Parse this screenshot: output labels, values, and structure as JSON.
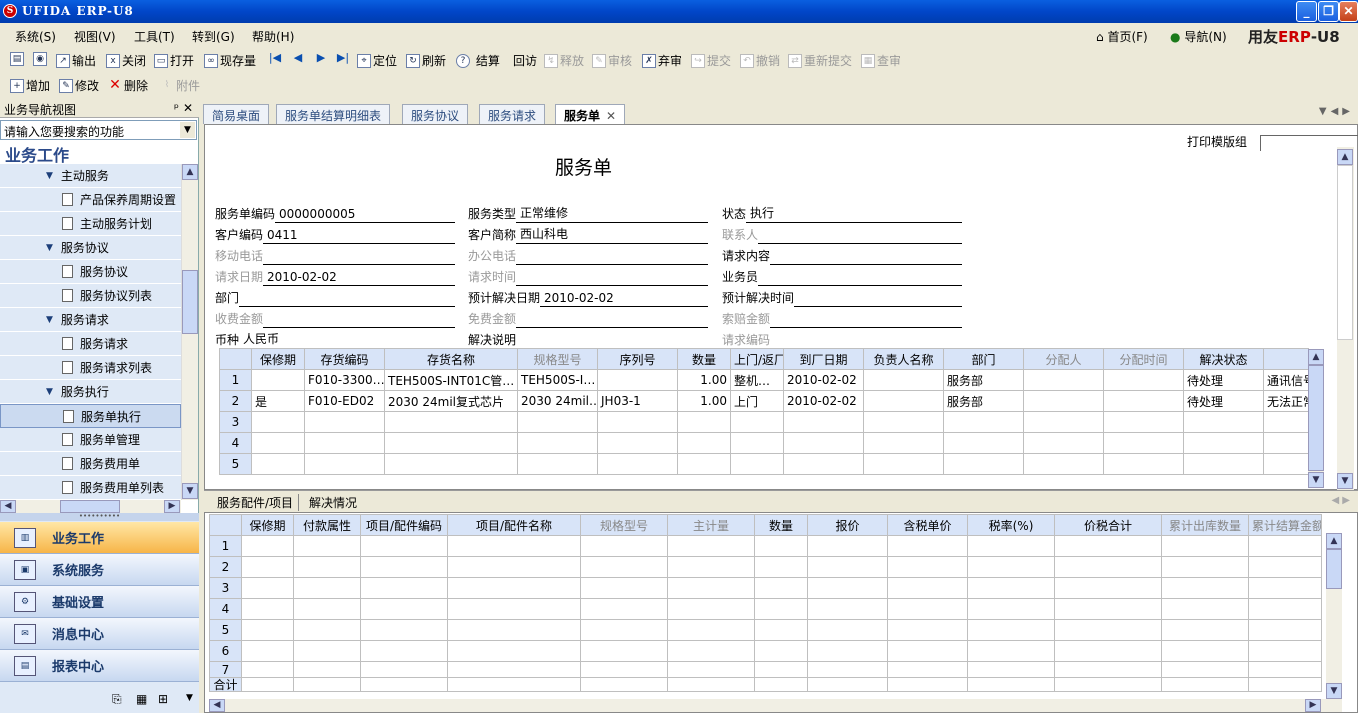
{
  "window": {
    "title": "UFIDA ERP-U8",
    "min": "_",
    "max": "❐",
    "close": "✕"
  },
  "menu": [
    "系统(S)",
    "视图(V)",
    "工具(T)",
    "转到(G)",
    "帮助(H)"
  ],
  "menu_right": {
    "home": "首页(F)",
    "navigate": "导航(N)"
  },
  "brand": {
    "a": "用友",
    "b": "ERP",
    "c": "-U8"
  },
  "toolbar1": [
    {
      "label": "输出",
      "dis": false
    },
    {
      "label": "关闭",
      "dis": false
    },
    {
      "label": "打开",
      "dis": false
    },
    {
      "label": "现存量",
      "dis": false
    },
    {
      "label": "定位",
      "dis": false
    },
    {
      "label": "刷新",
      "dis": false
    },
    {
      "label": "结算",
      "dis": false
    },
    {
      "label": "回访",
      "dis": false
    },
    {
      "label": "释放",
      "dis": true
    },
    {
      "label": "审核",
      "dis": true
    },
    {
      "label": "弃审",
      "dis": false
    },
    {
      "label": "提交",
      "dis": true
    },
    {
      "label": "撤销",
      "dis": true
    },
    {
      "label": "重新提交",
      "dis": true
    },
    {
      "label": "查审",
      "dis": true
    }
  ],
  "toolbar2": [
    {
      "label": "增加",
      "dis": false
    },
    {
      "label": "修改",
      "dis": false
    },
    {
      "label": "删除",
      "dis": false
    },
    {
      "label": "附件",
      "dis": true
    }
  ],
  "nav": {
    "header": "业务导航视图",
    "pin": "ᵖ",
    "close": "✕",
    "search_placeholder": "请输入您要搜索的功能",
    "section": "业务工作",
    "tree": [
      {
        "t": "grp",
        "label": "主动服务"
      },
      {
        "t": "leaf",
        "label": "产品保养周期设置"
      },
      {
        "t": "leaf",
        "label": "主动服务计划"
      },
      {
        "t": "grp",
        "label": "服务协议"
      },
      {
        "t": "leaf",
        "label": "服务协议"
      },
      {
        "t": "leaf",
        "label": "服务协议列表"
      },
      {
        "t": "grp",
        "label": "服务请求"
      },
      {
        "t": "leaf",
        "label": "服务请求"
      },
      {
        "t": "leaf",
        "label": "服务请求列表"
      },
      {
        "t": "grp",
        "label": "服务执行"
      },
      {
        "t": "leaf",
        "label": "服务单执行",
        "sel": true
      },
      {
        "t": "leaf",
        "label": "服务单管理"
      },
      {
        "t": "leaf",
        "label": "服务费用单"
      },
      {
        "t": "leaf",
        "label": "服务费用单列表"
      }
    ]
  },
  "outlook": [
    "业务工作",
    "系统服务",
    "基础设置",
    "消息中心",
    "报表中心"
  ],
  "tabs": [
    "简易桌面",
    "服务单结算明细表",
    "服务协议",
    "服务请求",
    "服务单"
  ],
  "form": {
    "title": "服务单",
    "print_template_label": "打印模版组",
    "fields": [
      {
        "label": "服务单编码",
        "value": "0000000005",
        "gray": false
      },
      {
        "label": "服务类型",
        "value": "正常维修",
        "gray": false
      },
      {
        "label": "状态",
        "value": "执行",
        "gray": false
      },
      {
        "label": "客户编码",
        "value": "0411",
        "gray": false
      },
      {
        "label": "客户简称",
        "value": "西山科电",
        "gray": false
      },
      {
        "label": "联系人",
        "value": "",
        "gray": true
      },
      {
        "label": "移动电话",
        "value": "",
        "gray": true
      },
      {
        "label": "办公电话",
        "value": "",
        "gray": true
      },
      {
        "label": "请求内容",
        "value": "",
        "gray": false
      },
      {
        "label": "请求日期",
        "value": "2010-02-02",
        "gray": true
      },
      {
        "label": "请求时间",
        "value": "",
        "gray": true
      },
      {
        "label": "业务员",
        "value": "",
        "gray": false
      },
      {
        "label": "部门",
        "value": "",
        "gray": false
      },
      {
        "label": "预计解决日期",
        "value": "2010-02-02",
        "gray": false
      },
      {
        "label": "预计解决时间",
        "value": "",
        "gray": false
      },
      {
        "label": "收费金额",
        "value": "",
        "gray": true
      },
      {
        "label": "免费金额",
        "value": "",
        "gray": true
      },
      {
        "label": "索赔金额",
        "value": "",
        "gray": true
      },
      {
        "label": "币种",
        "value": "人民币",
        "gray": false
      },
      {
        "label": "解决说明",
        "value": "",
        "gray": false
      },
      {
        "label": "请求编码",
        "value": "",
        "gray": true
      }
    ]
  },
  "grid1": {
    "columns": [
      {
        "label": "",
        "w": 32
      },
      {
        "label": "保修期",
        "w": 53
      },
      {
        "label": "存货编码",
        "w": 80
      },
      {
        "label": "存货名称",
        "w": 133
      },
      {
        "label": "规格型号",
        "w": 80,
        "g": true
      },
      {
        "label": "序列号",
        "w": 80
      },
      {
        "label": "数量",
        "w": 53
      },
      {
        "label": "上门/返厂",
        "w": 53
      },
      {
        "label": "到厂日期",
        "w": 80
      },
      {
        "label": "负责人名称",
        "w": 80
      },
      {
        "label": "部门",
        "w": 80
      },
      {
        "label": "分配人",
        "w": 80,
        "g": true
      },
      {
        "label": "分配时间",
        "w": 80,
        "g": true
      },
      {
        "label": "解决状态",
        "w": 80
      },
      {
        "label": "",
        "w": 45
      }
    ],
    "rows": [
      [
        "1",
        "",
        "F010-3300…",
        "TEH500S-INT01C管…",
        "TEH500S-I…",
        "",
        "1.00",
        "整机…",
        "2010-02-02",
        "",
        "服务部",
        "",
        "",
        "待处理",
        "通讯信号"
      ],
      [
        "2",
        "是",
        "F010-ED02",
        "2030 24mil复式芯片",
        "2030 24mil…",
        "JH03-1",
        "1.00",
        "上门",
        "2010-02-02",
        "",
        "服务部",
        "",
        "",
        "待处理",
        "无法正常"
      ],
      [
        "3",
        "",
        "",
        "",
        "",
        "",
        "",
        "",
        "",
        "",
        "",
        "",
        "",
        "",
        ""
      ],
      [
        "4",
        "",
        "",
        "",
        "",
        "",
        "",
        "",
        "",
        "",
        "",
        "",
        "",
        "",
        ""
      ],
      [
        "5",
        "",
        "",
        "",
        "",
        "",
        "",
        "",
        "",
        "",
        "",
        "",
        "",
        "",
        ""
      ]
    ]
  },
  "bottom_tabs": [
    "服务配件/项目",
    "解决情况"
  ],
  "grid2": {
    "columns": [
      {
        "label": "",
        "w": 32
      },
      {
        "label": "保修期",
        "w": 52
      },
      {
        "label": "付款属性",
        "w": 67
      },
      {
        "label": "项目/配件编码",
        "w": 87
      },
      {
        "label": "项目/配件名称",
        "w": 133
      },
      {
        "label": "规格型号",
        "w": 87,
        "g": true
      },
      {
        "label": "主计量",
        "w": 87,
        "g": true
      },
      {
        "label": "数量",
        "w": 53
      },
      {
        "label": "报价",
        "w": 80
      },
      {
        "label": "含税单价",
        "w": 80
      },
      {
        "label": "税率(%)",
        "w": 87
      },
      {
        "label": "价税合计",
        "w": 107
      },
      {
        "label": "累计出库数量",
        "w": 87,
        "g": true
      },
      {
        "label": "累计结算金额",
        "w": 73,
        "g": true
      }
    ],
    "rows": [
      "1",
      "2",
      "3",
      "4",
      "5",
      "6",
      "7"
    ],
    "total_label": "合计"
  }
}
